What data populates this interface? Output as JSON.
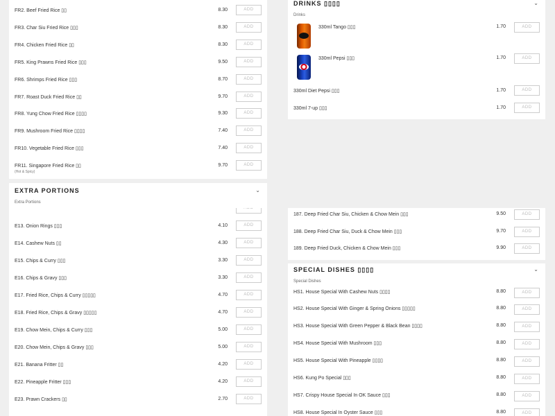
{
  "button_label": "ADD",
  "chevron": "⌄",
  "rice": [
    {
      "name": "FR2. Beef Fried Rice ▯▯",
      "price": "8.30"
    },
    {
      "name": "FR3. Char Siu Fried Rice ▯▯▯",
      "price": "8.30"
    },
    {
      "name": "FR4. Chicken Fried Rice ▯▯",
      "price": "8.30"
    },
    {
      "name": "FR5. King Prawns Fried Rice ▯▯▯",
      "price": "9.50"
    },
    {
      "name": "FR6. Shrimps Fried Rice ▯▯▯",
      "price": "8.70"
    },
    {
      "name": "FR7. Roast Duck Fried Rice ▯▯",
      "price": "9.70"
    },
    {
      "name": "FR8. Yung Chow Fried Rice ▯▯▯▯",
      "price": "9.30"
    },
    {
      "name": "FR9. Mushroom Fried Rice ▯▯▯▯",
      "price": "7.40"
    },
    {
      "name": "FR10. Vegetable Fried Rice ▯▯▯",
      "price": "7.40"
    },
    {
      "name": "FR11. Singapore Fried Rice ▯▯",
      "price": "9.70",
      "note": "(Hot & Spicy)"
    }
  ],
  "extra": {
    "title": "EXTRA PORTIONS",
    "subtitle": "Extra Portions",
    "items": [
      {
        "name": "E13. Onion Rings ▯▯▯",
        "price": "4.10"
      },
      {
        "name": "E14. Cashew Nuts ▯▯",
        "price": "4.30"
      },
      {
        "name": "E15. Chips & Curry ▯▯▯",
        "price": "3.30"
      },
      {
        "name": "E16. Chips & Gravy ▯▯▯",
        "price": "3.30"
      },
      {
        "name": "E17. Fried Rice, Chips & Curry ▯▯▯▯▯",
        "price": "4.70"
      },
      {
        "name": "E18. Fried Rice, Chips & Gravy ▯▯▯▯▯",
        "price": "4.70"
      },
      {
        "name": "E19. Chow Mein, Chips & Curry ▯▯▯",
        "price": "5.00"
      },
      {
        "name": "E20. Chow Mein, Chips & Gravy ▯▯▯",
        "price": "5.00"
      },
      {
        "name": "E21. Banana Fritter ▯▯",
        "price": "4.20"
      },
      {
        "name": "E22. Pineapple Fritter ▯▯▯",
        "price": "4.20"
      },
      {
        "name": "E23. Prawn Crackers ▯▯",
        "price": "2.70"
      }
    ]
  },
  "drinks": {
    "title": "DRINKS ▯▯▯▯",
    "subtitle": "Drinks",
    "items": [
      {
        "name": "330ml Tango ▯▯▯",
        "price": "1.70",
        "icon": "tango-can-icon"
      },
      {
        "name": "330ml Pepsi ▯▯▯",
        "price": "1.70",
        "icon": "pepsi-can-icon"
      },
      {
        "name": "330ml Diet Pepsi ▯▯▯",
        "price": "1.70"
      },
      {
        "name": "330ml 7-up ▯▯▯",
        "price": "1.70"
      }
    ]
  },
  "chow_mein": [
    {
      "name": "187. Deep Fried Char Siu, Chicken & Chow Mein ▯▯▯",
      "price": "9.50"
    },
    {
      "name": "188. Deep Fried Char Siu, Duck & Chow Mein ▯▯▯",
      "price": "9.70"
    },
    {
      "name": "189. Deep Fried Duck, Chicken & Chow Mein ▯▯▯",
      "price": "9.90"
    }
  ],
  "special": {
    "title": "SPECIAL DISHES ▯▯▯▯",
    "subtitle": "Special Dishes",
    "items": [
      {
        "name": "HS1. House Special With Cashew Nuts ▯▯▯▯",
        "price": "8.80"
      },
      {
        "name": "HS2. House Special With Ginger & Spring Onions ▯▯▯▯▯",
        "price": "8.80"
      },
      {
        "name": "HS3. House Special With Green Pepper & Black Bean ▯▯▯▯",
        "price": "8.80"
      },
      {
        "name": "HS4. House Special With Mushroom ▯▯▯",
        "price": "8.80"
      },
      {
        "name": "HS5. House Special With Pineapple ▯▯▯▯",
        "price": "8.80"
      },
      {
        "name": "HS6. Kung Po Special ▯▯▯",
        "price": "8.80"
      },
      {
        "name": "HS7. Crispy House Special In OK Sauce ▯▯▯",
        "price": "8.80"
      },
      {
        "name": "HS8. House Special In Oyster Sauce ▯▯▯",
        "price": "8.80"
      }
    ]
  }
}
